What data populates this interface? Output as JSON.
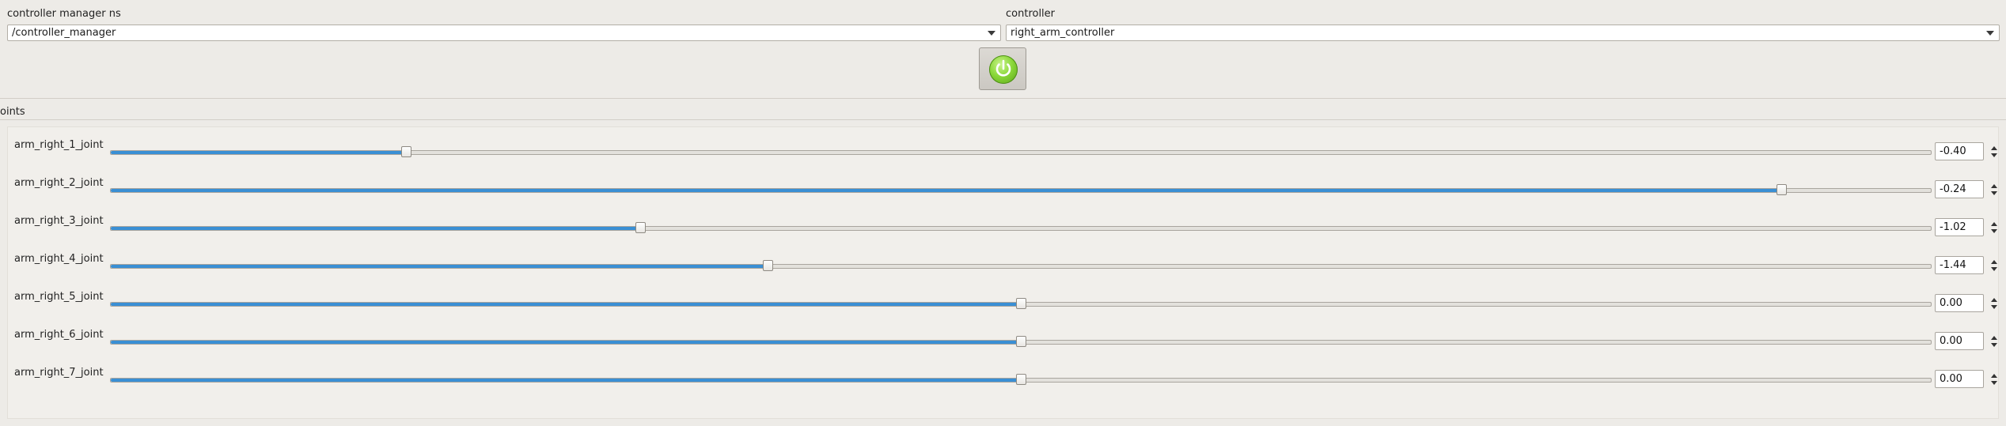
{
  "header": {
    "cm_label": "controller manager ns",
    "cm_value": "/controller_manager",
    "controller_label": "controller",
    "controller_value": "right_arm_controller",
    "power_button_icon": "power-icon",
    "accent": "#7bc92b"
  },
  "section": {
    "title": "oints"
  },
  "joints": [
    {
      "name": "arm_right_1_joint",
      "value": "-0.40",
      "position": 0.162
    },
    {
      "name": "arm_right_2_joint",
      "value": "-0.24",
      "position": 0.918
    },
    {
      "name": "arm_right_3_joint",
      "value": "-1.02",
      "position": 0.291
    },
    {
      "name": "arm_right_4_joint",
      "value": "-1.44",
      "position": 0.361
    },
    {
      "name": "arm_right_5_joint",
      "value": "0.00",
      "position": 0.5
    },
    {
      "name": "arm_right_6_joint",
      "value": "0.00",
      "position": 0.5
    },
    {
      "name": "arm_right_7_joint",
      "value": "0.00",
      "position": 0.5
    }
  ],
  "colors": {
    "slider_fill": "#3a8fd4",
    "background": "#edebe7"
  }
}
